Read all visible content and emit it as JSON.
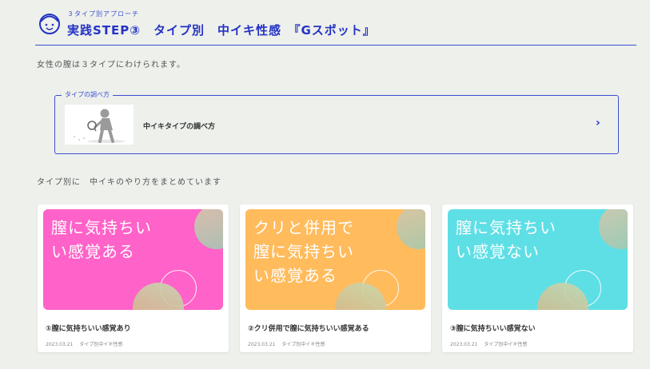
{
  "header": {
    "kicker": "３タイプ別アプローチ",
    "title": "実践STEP③　タイプ別　中イキ性感　『Gスポット』",
    "accent_color": "#2433c4"
  },
  "intro_text": "女性の膣は３タイプにわけられます。",
  "link_box": {
    "legend": "タイプの調べ方",
    "text": "中イキタイプの調べ方",
    "arrow": "›",
    "thumb_icon": "figure-with-magnifier-icon"
  },
  "section_text": "タイプ別に　中イキのやり方をまとめています",
  "cards": [
    {
      "banner_text": "膣に気持ちい\nい感覚ある",
      "banner_color": "#ff62c8",
      "title": "①膣に気持ちいい感覚あり",
      "date": "2023.03.21",
      "category": "タイプ別中イキ性感"
    },
    {
      "banner_text": "クリと併用で\n膣に気持ちい\nい感覚ある",
      "banner_color": "#ffbb5c",
      "title": "②クリ併用で膣に気持ちいい感覚ある",
      "date": "2023.03.21",
      "category": "タイプ別中イキ性感"
    },
    {
      "banner_text": "膣に気持ちい\nい感覚ない",
      "banner_color": "#5edfe5",
      "title": "③膣に気持ちいい感覚ない",
      "date": "2023.03.21",
      "category": "タイプ別中イキ性感"
    }
  ]
}
